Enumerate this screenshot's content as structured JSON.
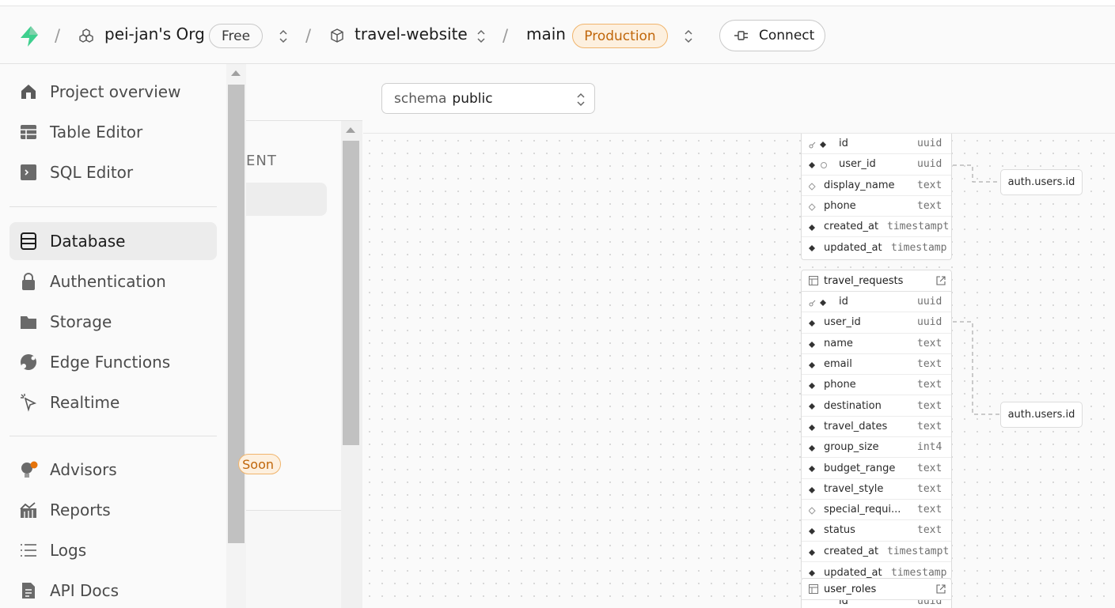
{
  "topbar": {
    "org_name": "pei-jan's Org",
    "plan_badge": "Free",
    "project_name": "travel-website",
    "branch_name": "main",
    "env_badge": "Production",
    "connect_label": "Connect"
  },
  "nav": {
    "items": [
      {
        "label": "Project overview",
        "icon": "home-icon"
      },
      {
        "label": "Table Editor",
        "icon": "table-icon"
      },
      {
        "label": "SQL Editor",
        "icon": "terminal-icon"
      },
      {
        "label": "Database",
        "icon": "database-icon",
        "active": true
      },
      {
        "label": "Authentication",
        "icon": "lock-icon"
      },
      {
        "label": "Storage",
        "icon": "folder-icon"
      },
      {
        "label": "Edge Functions",
        "icon": "globe-icon"
      },
      {
        "label": "Realtime",
        "icon": "cursor-icon"
      },
      {
        "label": "Advisors",
        "icon": "lightbulb-icon"
      },
      {
        "label": "Reports",
        "icon": "chart-icon"
      },
      {
        "label": "Logs",
        "icon": "list-icon"
      },
      {
        "label": "API Docs",
        "icon": "document-icon"
      }
    ]
  },
  "midpanel": {
    "heading_fragment": "ENT",
    "soon_fragment": "Soon"
  },
  "schema": {
    "key": "schema",
    "value": "public"
  },
  "tables": {
    "profiles_partial": {
      "columns": [
        {
          "name": "id",
          "type": "uuid"
        },
        {
          "name": "user_id",
          "type": "uuid"
        },
        {
          "name": "display_name",
          "type": "text"
        },
        {
          "name": "phone",
          "type": "text"
        },
        {
          "name": "created_at",
          "type": "timestampt"
        },
        {
          "name": "updated_at",
          "type": "timestamp"
        }
      ]
    },
    "travel_requests": {
      "name": "travel_requests",
      "columns": [
        {
          "name": "id",
          "type": "uuid"
        },
        {
          "name": "user_id",
          "type": "uuid"
        },
        {
          "name": "name",
          "type": "text"
        },
        {
          "name": "email",
          "type": "text"
        },
        {
          "name": "phone",
          "type": "text"
        },
        {
          "name": "destination",
          "type": "text"
        },
        {
          "name": "travel_dates",
          "type": "text"
        },
        {
          "name": "group_size",
          "type": "int4"
        },
        {
          "name": "budget_range",
          "type": "text"
        },
        {
          "name": "travel_style",
          "type": "text"
        },
        {
          "name": "special_requi...",
          "type": "text"
        },
        {
          "name": "status",
          "type": "text"
        },
        {
          "name": "created_at",
          "type": "timestampt"
        },
        {
          "name": "updated_at",
          "type": "timestamp"
        }
      ]
    },
    "user_roles": {
      "name": "user_roles",
      "columns": [
        {
          "name": "id",
          "type": "uuid"
        }
      ]
    }
  },
  "refs": {
    "ref1": "auth.users.id",
    "ref2": "auth.users.id"
  },
  "colors": {
    "accent_green": "#3ecf8e",
    "production_orange": "#c0660a",
    "advisor_dot": "#e5730a"
  }
}
